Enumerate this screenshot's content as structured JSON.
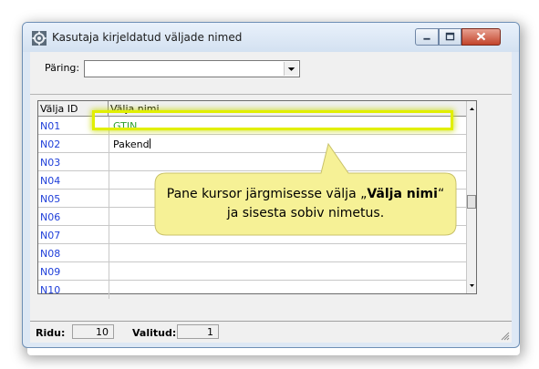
{
  "window": {
    "title": "Kasutaja kirjeldatud väljade nimed",
    "icon": "gear-cog-icon"
  },
  "query": {
    "label": "Päring:",
    "value": ""
  },
  "grid": {
    "columns": [
      "Välja ID",
      "Välja nimi"
    ],
    "rows": [
      {
        "id": "N01",
        "name": "GTIN"
      },
      {
        "id": "N02",
        "name": "Pakend"
      },
      {
        "id": "N03",
        "name": ""
      },
      {
        "id": "N04",
        "name": ""
      },
      {
        "id": "N05",
        "name": ""
      },
      {
        "id": "N06",
        "name": ""
      },
      {
        "id": "N07",
        "name": ""
      },
      {
        "id": "N08",
        "name": ""
      },
      {
        "id": "N09",
        "name": ""
      },
      {
        "id": "N10",
        "name": ""
      }
    ]
  },
  "status": {
    "rows_label": "Ridu:",
    "rows_value": "10",
    "selected_label": "Valitud:",
    "selected_value": "1"
  },
  "callout": {
    "line1_before": "Pane kursor järgmisesse välja „",
    "line1_bold": "Välja nimi",
    "line1_after": "“",
    "line2": "ja sisesta sobiv nimetus."
  },
  "colors": {
    "id_text": "#1f3fd9",
    "gtin_text": "#2e9e2e",
    "highlight": "#e1ef00",
    "callout_fill": "#f6f196"
  }
}
